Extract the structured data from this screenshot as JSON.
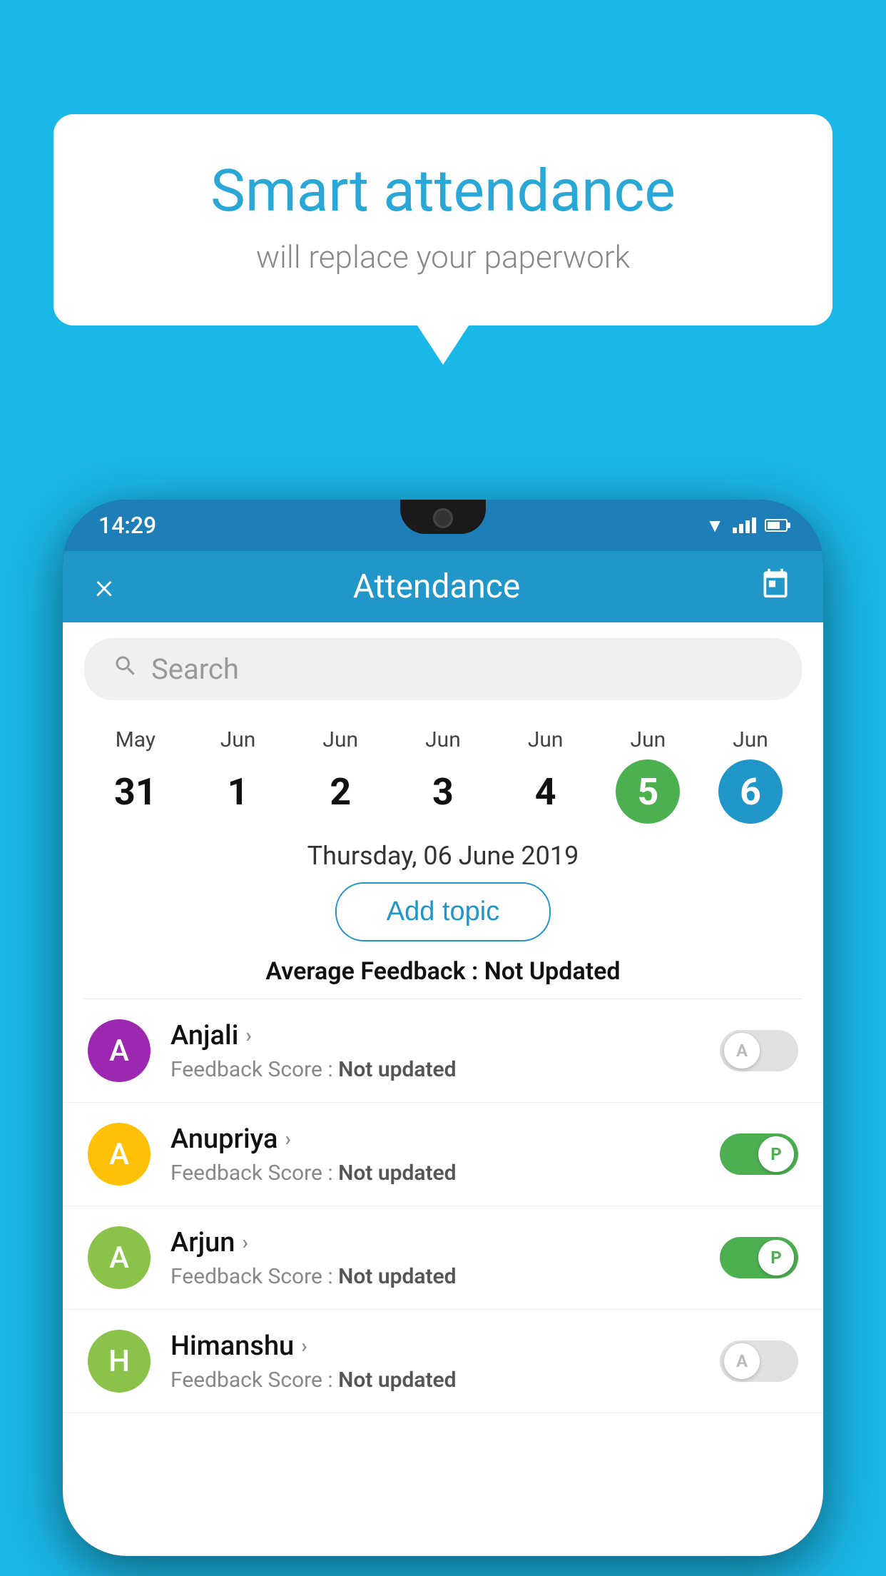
{
  "background_color": "#1ab8e8",
  "bubble": {
    "title": "Smart attendance",
    "subtitle": "will replace your paperwork"
  },
  "phone": {
    "status_bar": {
      "time": "14:29"
    },
    "header": {
      "title": "Attendance",
      "close_label": "×",
      "calendar_icon": "calendar-icon"
    },
    "search": {
      "placeholder": "Search"
    },
    "calendar": {
      "days": [
        {
          "month": "May",
          "date": "31",
          "state": "normal"
        },
        {
          "month": "Jun",
          "date": "1",
          "state": "normal"
        },
        {
          "month": "Jun",
          "date": "2",
          "state": "normal"
        },
        {
          "month": "Jun",
          "date": "3",
          "state": "normal"
        },
        {
          "month": "Jun",
          "date": "4",
          "state": "normal"
        },
        {
          "month": "Jun",
          "date": "5",
          "state": "today"
        },
        {
          "month": "Jun",
          "date": "6",
          "state": "selected"
        }
      ]
    },
    "selected_date": "Thursday, 06 June 2019",
    "add_topic_label": "Add topic",
    "avg_feedback_label": "Average Feedback :",
    "avg_feedback_value": "Not Updated",
    "students": [
      {
        "name": "Anjali",
        "initial": "A",
        "avatar_color": "#9c27b0",
        "feedback_label": "Feedback Score :",
        "feedback_value": "Not updated",
        "attendance": "absent",
        "toggle_letter": "A"
      },
      {
        "name": "Anupriya",
        "initial": "A",
        "avatar_color": "#ffc107",
        "feedback_label": "Feedback Score :",
        "feedback_value": "Not updated",
        "attendance": "present",
        "toggle_letter": "P"
      },
      {
        "name": "Arjun",
        "initial": "A",
        "avatar_color": "#8bc34a",
        "feedback_label": "Feedback Score :",
        "feedback_value": "Not updated",
        "attendance": "present",
        "toggle_letter": "P"
      },
      {
        "name": "Himanshu",
        "initial": "H",
        "avatar_color": "#8bc34a",
        "feedback_label": "Feedback Score :",
        "feedback_value": "Not updated",
        "attendance": "absent",
        "toggle_letter": "A"
      }
    ]
  }
}
